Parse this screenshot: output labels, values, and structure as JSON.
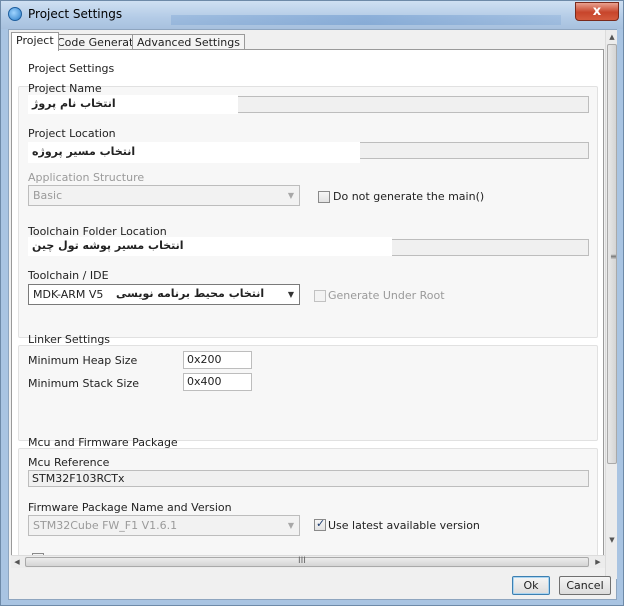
{
  "window": {
    "title": "Project Settings",
    "close_label": "x"
  },
  "tabs": [
    {
      "label": "Project",
      "active": true
    },
    {
      "label": "Code Generator",
      "active": false
    },
    {
      "label": "Advanced Settings",
      "active": false
    }
  ],
  "project_settings": {
    "group_title": "Project Settings",
    "project_name_label": "Project Name",
    "project_name_value": "",
    "project_name_annotation": "انتخاب نام پروژ",
    "project_location_label": "Project Location",
    "project_location_value": "",
    "project_location_annotation": "انتخاب مسیر پروژه",
    "application_structure_label": "Application Structure",
    "application_structure_value": "Basic",
    "do_not_generate_main_label": "Do not generate the main()",
    "do_not_generate_main_checked": false,
    "toolchain_folder_label": "Toolchain Folder Location",
    "toolchain_folder_value": "",
    "toolchain_folder_annotation": "انتخاب مسیر پوشه تول چین",
    "toolchain_ide_label": "Toolchain / IDE",
    "toolchain_ide_value": "MDK-ARM V5",
    "toolchain_ide_annotation": "انتخاب محیط برنامه نویسی",
    "generate_under_root_label": "Generate Under Root",
    "generate_under_root_checked": false
  },
  "linker_settings": {
    "group_title": "Linker Settings",
    "min_heap_label": "Minimum Heap Size",
    "min_heap_value": "0x200",
    "min_stack_label": "Minimum Stack Size",
    "min_stack_value": "0x400"
  },
  "mcu_firmware": {
    "group_title": "Mcu and Firmware Package",
    "mcu_reference_label": "Mcu Reference",
    "mcu_reference_value": "STM32F103RCTx",
    "firmware_package_label": "Firmware Package Name and Version",
    "firmware_package_value": "STM32Cube FW_F1 V1.6.1",
    "use_latest_label": "Use latest available version",
    "use_latest_checked": true
  },
  "scrollbars": {
    "up_arrow": "▲",
    "down_arrow": "▼",
    "left_arrow": "◀",
    "right_arrow": "▶",
    "grip": "≡",
    "hgrip": "III"
  },
  "buttons": {
    "ok_label": "Ok",
    "cancel_label": "Cancel"
  }
}
